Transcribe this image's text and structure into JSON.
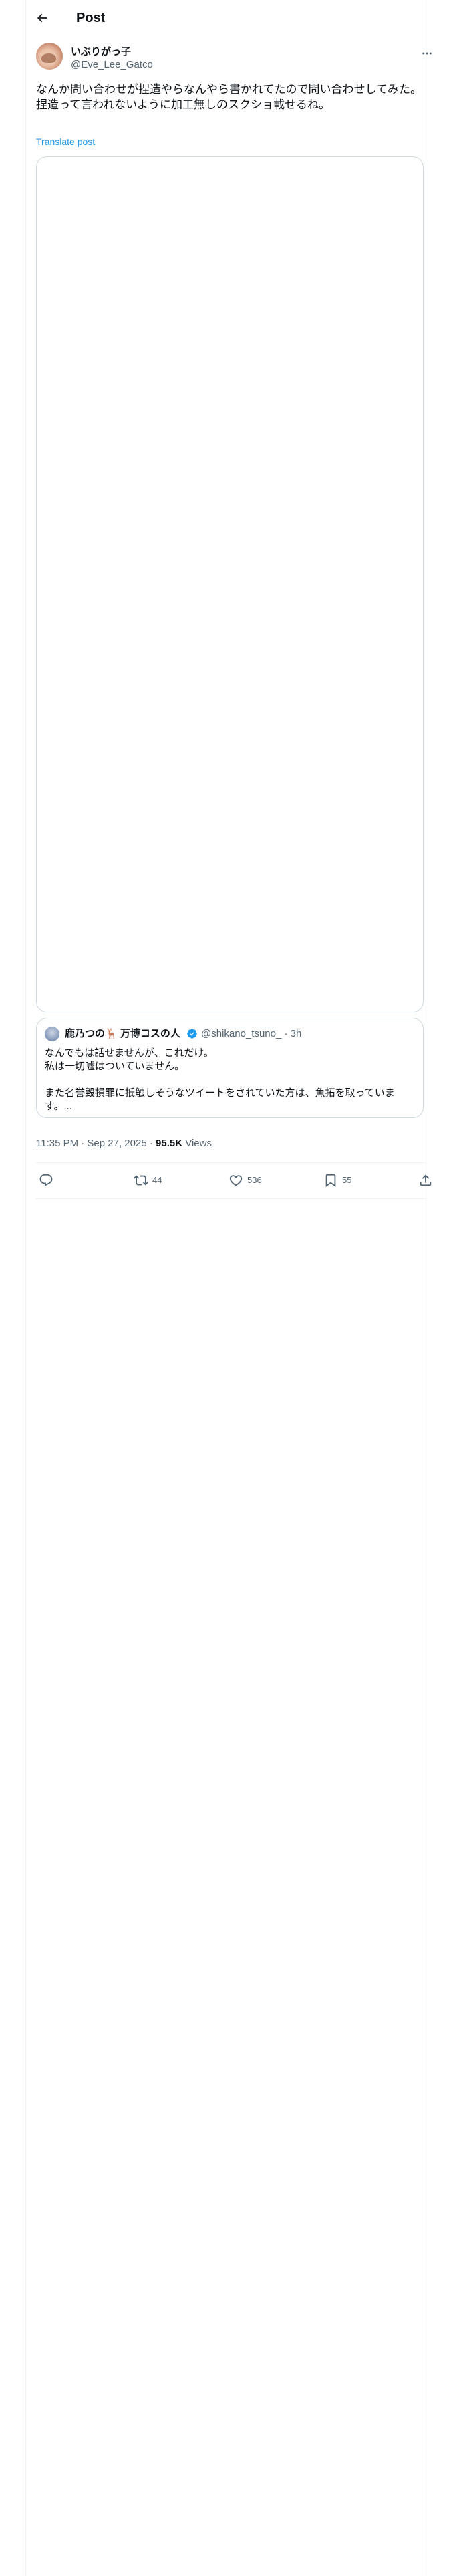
{
  "header": {
    "title": "Post"
  },
  "author": {
    "display_name": "いぶりがっ子",
    "handle": "@Eve_Lee_Gatco"
  },
  "tweet": {
    "text": "なんか問い合わせが捏造やらなんやら書かれてたので問い合わせしてみた。\n捏造って言われないように加工無しのスクショ載せるね。",
    "translate_label": "Translate post"
  },
  "quote": {
    "display_name": "鹿乃つの🦌 万博コスの人",
    "handle": "@shikano_tsuno_",
    "time": "· 3h",
    "text": "なんでもは話せませんが、これだけ。\n私は一切嘘はついていません。\n\nまた名誉毀損罪に抵触しそうなツイートをされていた方は、魚拓を取っています。..."
  },
  "meta": {
    "datetime": "11:35 PM · Sep 27, 2025",
    "separator": " · ",
    "views_count": "95.5K",
    "views_label": " Views"
  },
  "actions": {
    "reply_count": "",
    "retweet_count": "44",
    "like_count": "536",
    "bookmark_count": "55"
  },
  "colors": {
    "accent": "#1d9bf0",
    "text": "#0f1419",
    "muted": "#536471",
    "border": "#cfd9de"
  },
  "icons": [
    "back-arrow-icon",
    "more-icon",
    "verified-badge-icon",
    "reply-icon",
    "retweet-icon",
    "like-icon",
    "bookmark-icon",
    "share-icon"
  ]
}
